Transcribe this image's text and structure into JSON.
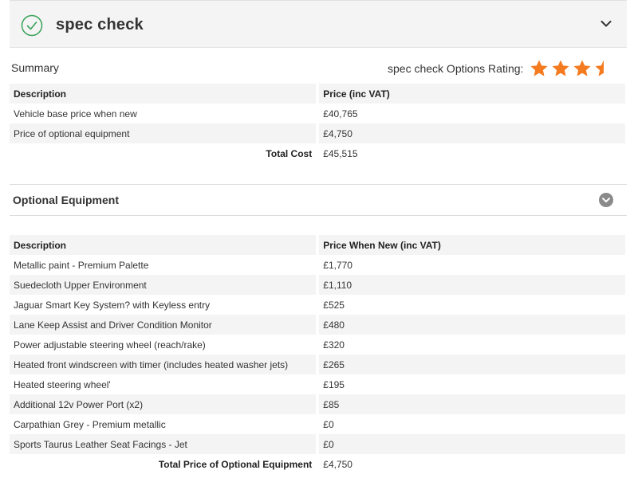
{
  "header": {
    "title": "spec check",
    "icon": "check-circle-icon",
    "toggle_icon": "chevron-down-icon"
  },
  "summary": {
    "label": "Summary",
    "rating_label": "spec check Options Rating:",
    "rating_value": 3.5,
    "rating_max": 4,
    "columns": [
      "Description",
      "Price (inc VAT)"
    ],
    "rows": [
      {
        "description": "Vehicle base price when new",
        "price": "£40,765"
      },
      {
        "description": "Price of optional equipment",
        "price": "£4,750"
      }
    ],
    "total_label": "Total Cost",
    "total_value": "£45,515"
  },
  "equipment": {
    "title": "Optional Equipment",
    "toggle_icon": "chevron-down-circle-icon",
    "columns": [
      "Description",
      "Price When New (inc VAT)"
    ],
    "rows": [
      {
        "description": "Metallic paint - Premium Palette",
        "price": "£1,770"
      },
      {
        "description": "Suedecloth Upper Environment",
        "price": "£1,110"
      },
      {
        "description": "Jaguar Smart Key System? with Keyless entry",
        "price": "£525"
      },
      {
        "description": "Lane Keep Assist and Driver Condition Monitor",
        "price": "£480"
      },
      {
        "description": "Power adjustable steering wheel (reach/rake)",
        "price": "£320"
      },
      {
        "description": "Heated front windscreen with timer (includes heated washer jets)",
        "price": "£265"
      },
      {
        "description": "Heated steering wheel'",
        "price": "£195"
      },
      {
        "description": "Additional 12v Power Port (x2)",
        "price": "£85"
      },
      {
        "description": "Carpathian Grey - Premium metallic",
        "price": "£0"
      },
      {
        "description": "Sports Taurus Leather Seat Facings - Jet",
        "price": "£0"
      }
    ],
    "total_label": "Total Price of Optional Equipment",
    "total_value": "£4,750"
  },
  "colors": {
    "accent_green": "#3aa35a",
    "star_orange": "#f47b20",
    "row_shade": "#f4f4f4",
    "toggle_grey": "#8a8a8a"
  }
}
